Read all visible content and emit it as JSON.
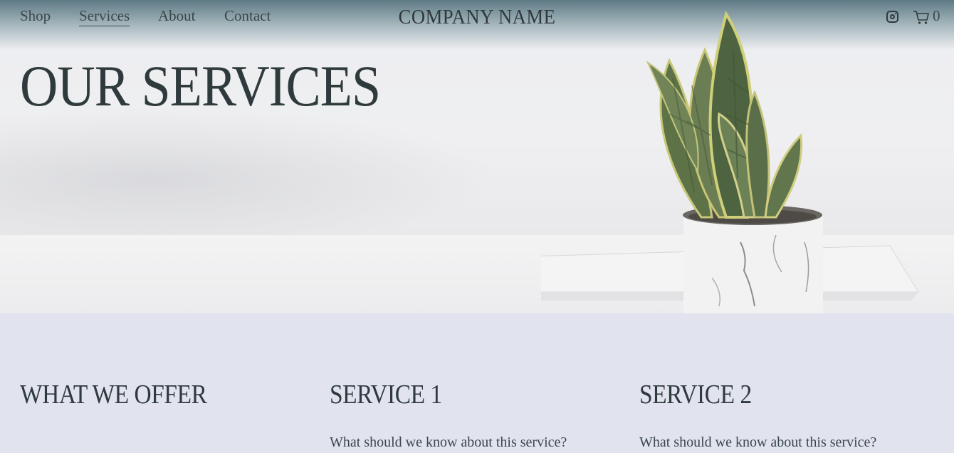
{
  "nav": {
    "links": [
      "Shop",
      "Services",
      "About",
      "Contact"
    ],
    "active": "Services",
    "brand": "COMPANY NAME",
    "cart_count": "0"
  },
  "hero": {
    "title": "OUR SERVICES"
  },
  "offer": {
    "heading": "WHAT WE OFFER",
    "services": [
      {
        "title": "SERVICE 1",
        "description": "What should we know about this service?"
      },
      {
        "title": "SERVICE 2",
        "description": "What should we know about this service?"
      }
    ]
  },
  "colors": {
    "text": "#2f3a3d",
    "section_bg": "#e1e3ee",
    "nav_fade": "#5e7a85"
  },
  "icons": [
    "instagram-icon",
    "cart-icon"
  ]
}
